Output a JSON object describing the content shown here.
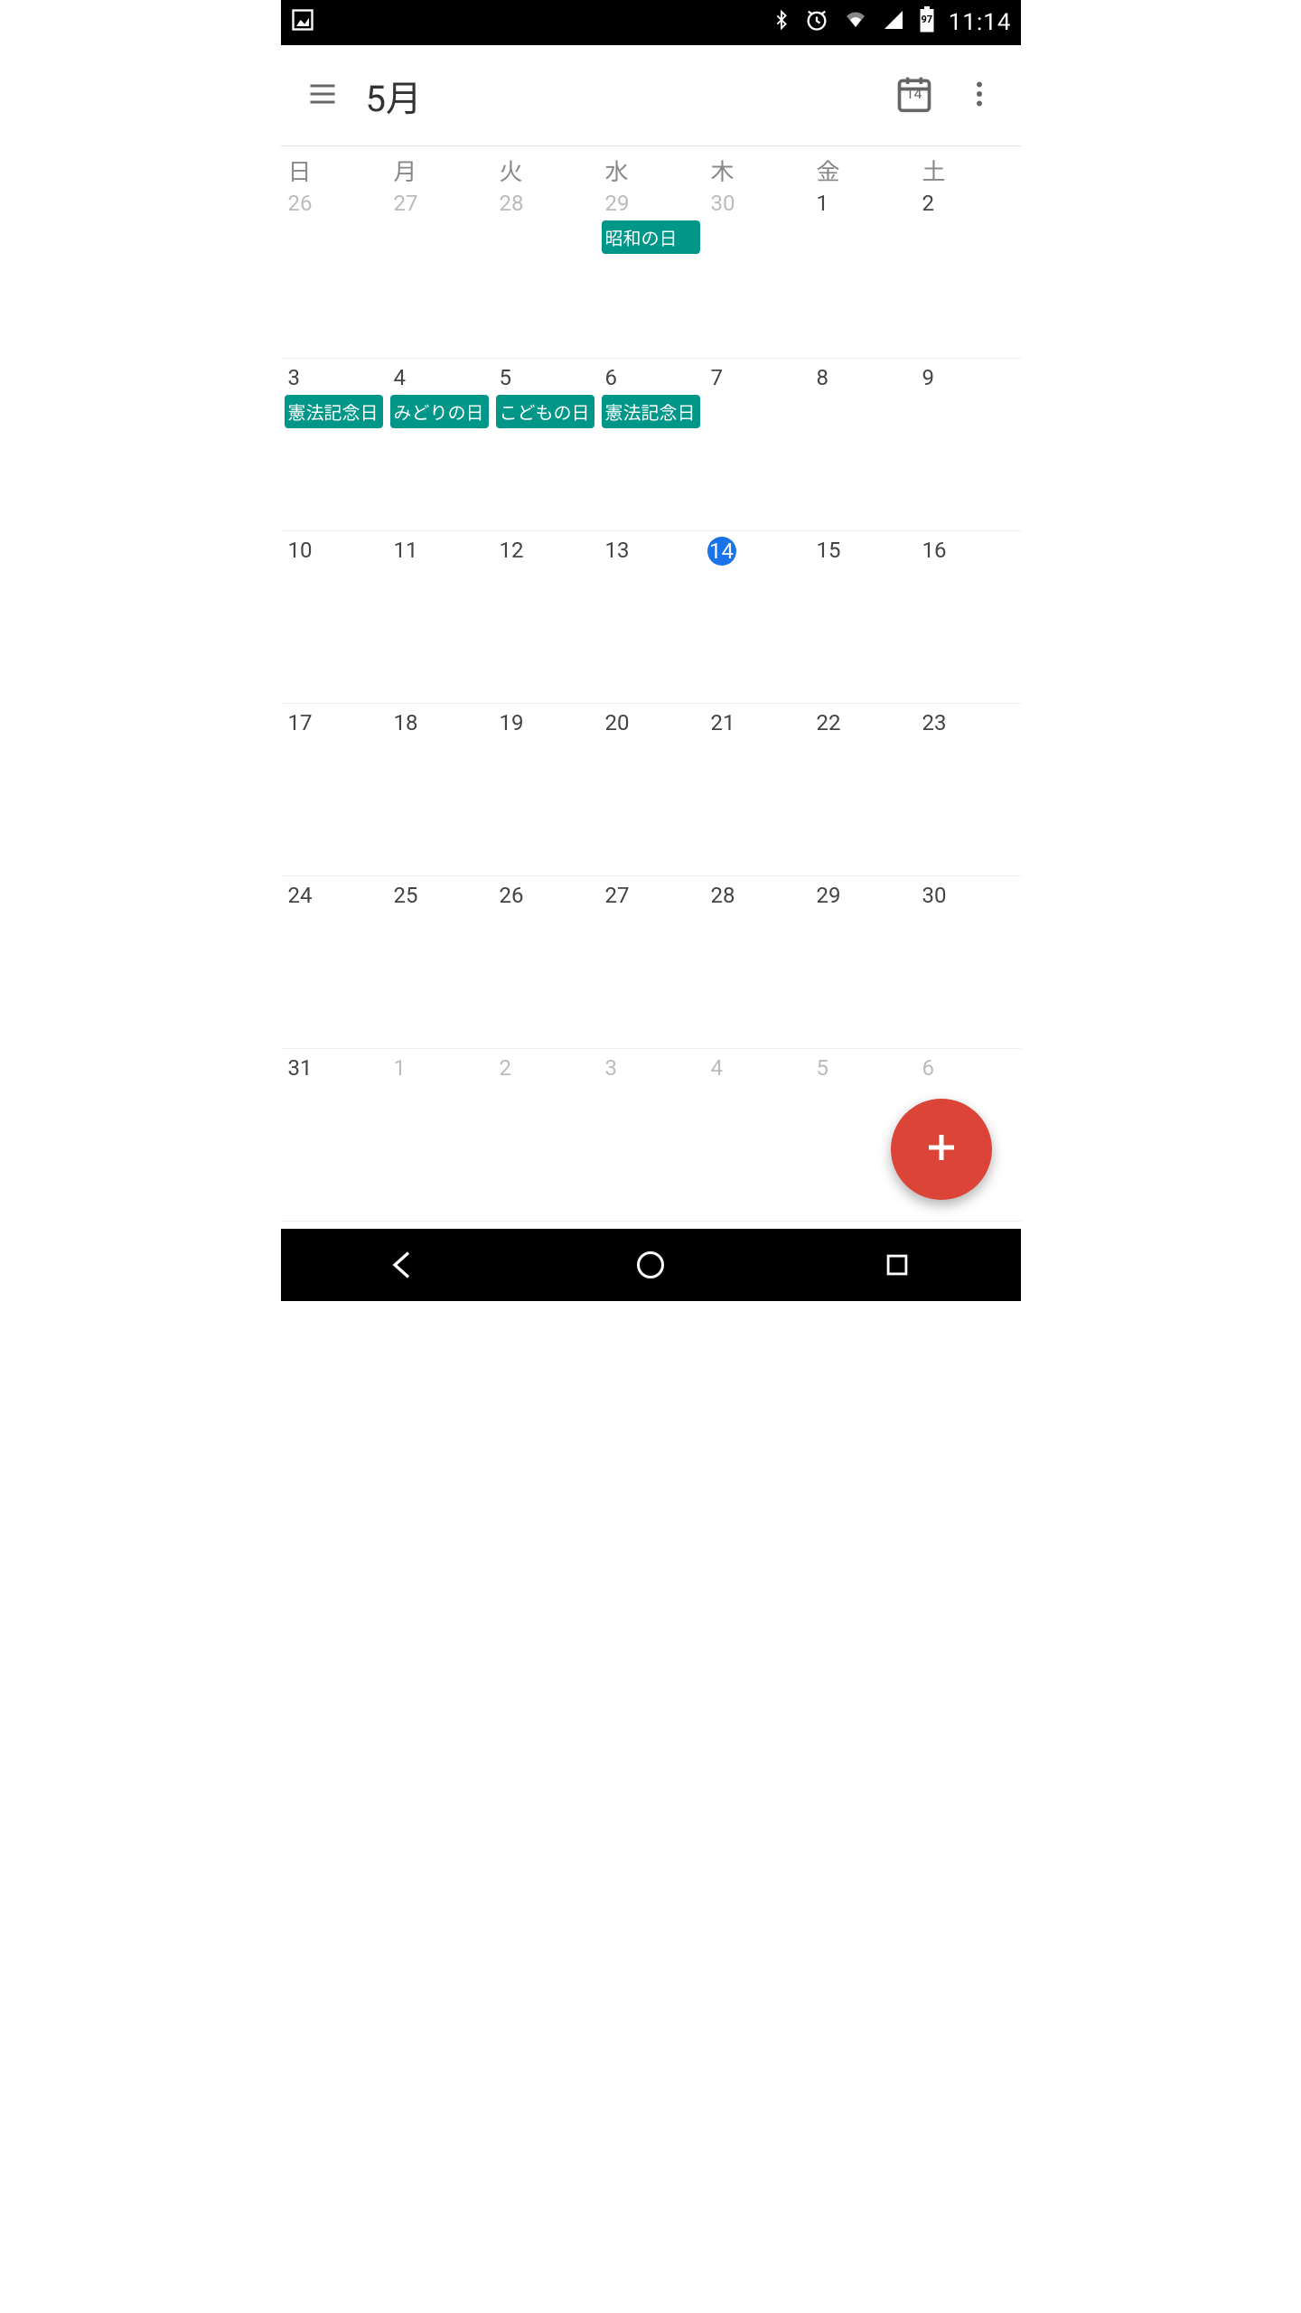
{
  "statusbar": {
    "time": "11:14",
    "battery_label": "97"
  },
  "appbar": {
    "title": "5月",
    "today_badge": "14"
  },
  "day_headers": [
    "日",
    "月",
    "火",
    "水",
    "木",
    "金",
    "土"
  ],
  "weeks": [
    [
      {
        "n": "26",
        "outside": true
      },
      {
        "n": "27",
        "outside": true
      },
      {
        "n": "28",
        "outside": true
      },
      {
        "n": "29",
        "outside": true,
        "events": [
          "昭和の日"
        ]
      },
      {
        "n": "30",
        "outside": true
      },
      {
        "n": "1"
      },
      {
        "n": "2"
      }
    ],
    [
      {
        "n": "3",
        "events": [
          "憲法記念日"
        ]
      },
      {
        "n": "4",
        "events": [
          "みどりの日"
        ]
      },
      {
        "n": "5",
        "events": [
          "こどもの日"
        ]
      },
      {
        "n": "6",
        "events": [
          "憲法記念日"
        ]
      },
      {
        "n": "7"
      },
      {
        "n": "8"
      },
      {
        "n": "9"
      }
    ],
    [
      {
        "n": "10"
      },
      {
        "n": "11"
      },
      {
        "n": "12"
      },
      {
        "n": "13"
      },
      {
        "n": "14",
        "today": true
      },
      {
        "n": "15"
      },
      {
        "n": "16"
      }
    ],
    [
      {
        "n": "17"
      },
      {
        "n": "18"
      },
      {
        "n": "19"
      },
      {
        "n": "20"
      },
      {
        "n": "21"
      },
      {
        "n": "22"
      },
      {
        "n": "23"
      }
    ],
    [
      {
        "n": "24"
      },
      {
        "n": "25"
      },
      {
        "n": "26"
      },
      {
        "n": "27"
      },
      {
        "n": "28"
      },
      {
        "n": "29"
      },
      {
        "n": "30"
      }
    ],
    [
      {
        "n": "31"
      },
      {
        "n": "1",
        "outside": true
      },
      {
        "n": "2",
        "outside": true
      },
      {
        "n": "3",
        "outside": true
      },
      {
        "n": "4",
        "outside": true
      },
      {
        "n": "5",
        "outside": true
      },
      {
        "n": "6",
        "outside": true
      }
    ]
  ]
}
